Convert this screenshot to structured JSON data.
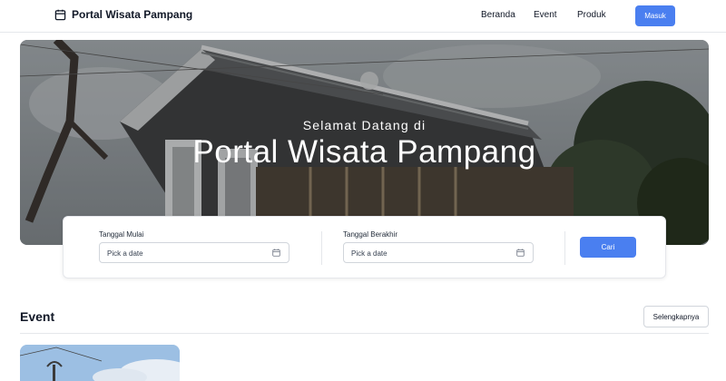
{
  "navbar": {
    "brand": "Portal Wisata Pampang",
    "brand_icon": "calendar-box-icon",
    "links": [
      "Beranda",
      "Event",
      "Produk"
    ],
    "login_label": "Masuk"
  },
  "hero": {
    "subtitle": "Selamat Datang di",
    "title": "Portal Wisata Pampang"
  },
  "search": {
    "start_label": "Tanggal Mulai",
    "start_placeholder": "Pick a date",
    "end_label": "Tanggal Berakhir",
    "end_placeholder": "Pick a date",
    "submit_label": "Cari",
    "calendar_icon": "calendar-icon"
  },
  "events_section": {
    "title": "Event",
    "more_label": "Selengkapnya"
  },
  "colors": {
    "primary": "#4a7ff0",
    "border": "#e5e7eb",
    "text": "#111827"
  }
}
